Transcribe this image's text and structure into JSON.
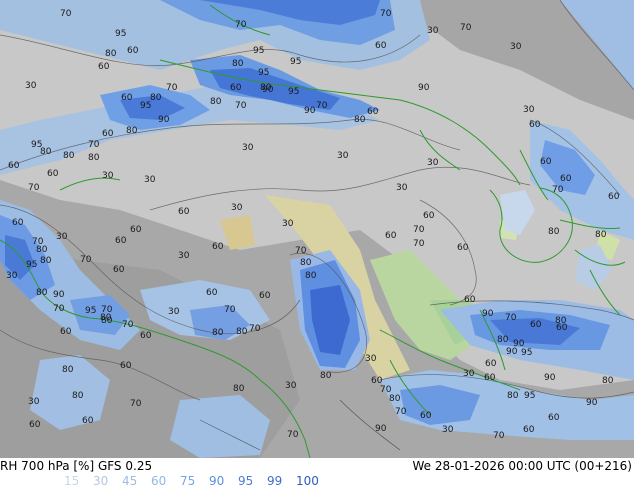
{
  "title": "RH 700 hPa [%] GFS 0.25",
  "valid": "We 28-01-2026 00:00 UTC (00+216)",
  "legend": [
    {
      "value": "15",
      "color": "#c6d4e6"
    },
    {
      "value": "30",
      "color": "#b4c8e0"
    },
    {
      "value": "45",
      "color": "#a0bcdc"
    },
    {
      "value": "60",
      "color": "#8eb8e8"
    },
    {
      "value": "75",
      "color": "#74a8e4"
    },
    {
      "value": "90",
      "color": "#5a90e0"
    },
    {
      "value": "95",
      "color": "#4a7ed8"
    },
    {
      "value": "99",
      "color": "#3c6ccc"
    },
    {
      "value": "100",
      "color": "#2c5cc0"
    }
  ],
  "contour_labels": [
    "70",
    "95",
    "70",
    "70",
    "30",
    "70",
    "80",
    "60",
    "95",
    "60",
    "80",
    "60",
    "95",
    "30",
    "95",
    "60",
    "70",
    "80",
    "30",
    "90",
    "95",
    "90",
    "80",
    "60",
    "80",
    "60",
    "70",
    "80",
    "90",
    "95",
    "90",
    "70",
    "80",
    "60",
    "30",
    "60",
    "30",
    "30",
    "95",
    "70",
    "80",
    "80",
    "80",
    "60",
    "60",
    "70",
    "30",
    "30",
    "60",
    "30",
    "70",
    "60",
    "30",
    "60",
    "60",
    "30",
    "60",
    "60",
    "30",
    "60",
    "80",
    "70",
    "80",
    "60",
    "70",
    "30",
    "60",
    "70",
    "80",
    "60",
    "95",
    "70",
    "60",
    "80",
    "30",
    "30",
    "70",
    "60",
    "80",
    "80",
    "60",
    "90",
    "60",
    "80",
    "95",
    "70",
    "90",
    "60",
    "80",
    "70",
    "60",
    "70",
    "70",
    "70",
    "60",
    "80",
    "70",
    "90",
    "90",
    "80",
    "80",
    "95",
    "30",
    "60",
    "80",
    "80",
    "60",
    "60",
    "30",
    "80",
    "90",
    "60",
    "80",
    "30",
    "80",
    "90",
    "80",
    "80",
    "60",
    "60",
    "30",
    "80",
    "95",
    "70",
    "70",
    "80",
    "70",
    "60",
    "30",
    "60",
    "90",
    "70",
    "70",
    "60",
    "30",
    "60",
    "60"
  ]
}
